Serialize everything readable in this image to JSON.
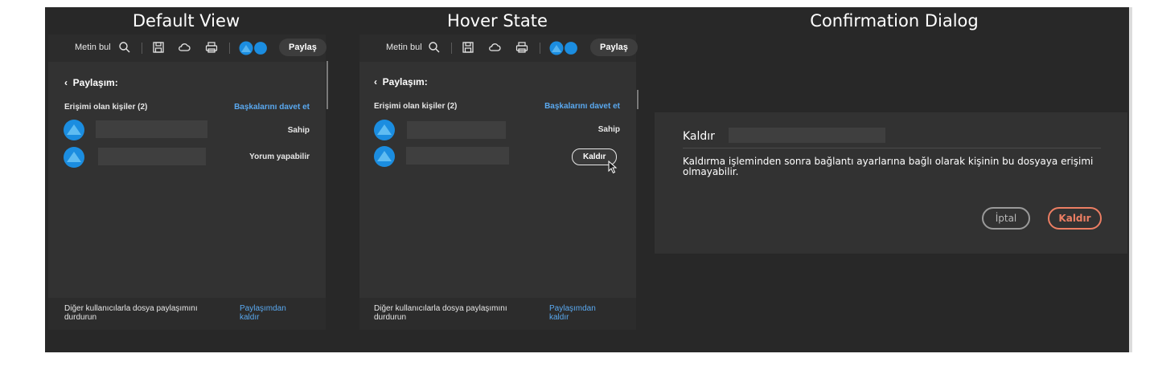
{
  "headings": {
    "default": "Default View",
    "hover": "Hover State",
    "dialog": "Confirmation Dialog"
  },
  "toolbar": {
    "find_label": "Metin bul",
    "share_label": "Paylaş",
    "icons": [
      "search-icon",
      "save-icon",
      "cloud-icon",
      "print-icon"
    ]
  },
  "panel": {
    "back_label": "Paylaşım:",
    "access_label": "Erişimi olan kişiler (2)",
    "invite_label": "Başkalarını davet et",
    "people": [
      {
        "role": "Sahip"
      },
      {
        "role": "Yorum yapabilir"
      }
    ],
    "hover_remove_label": "Kaldır",
    "footer_text": "Diğer kullanıcılarla dosya paylaşımını durdurun",
    "footer_link": "Paylaşımdan kaldır"
  },
  "dialog": {
    "title": "Kaldır",
    "body": "Kaldırma işleminden sonra bağlantı ayarlarına bağlı olarak kişinin bu dosyaya erişimi olmayabilir.",
    "cancel_label": "İptal",
    "remove_label": "Kaldır"
  },
  "colors": {
    "background": "#282828",
    "panel": "#323232",
    "link": "#5aa9f0",
    "avatar": "#1b8de0",
    "danger": "#ec7e63"
  }
}
